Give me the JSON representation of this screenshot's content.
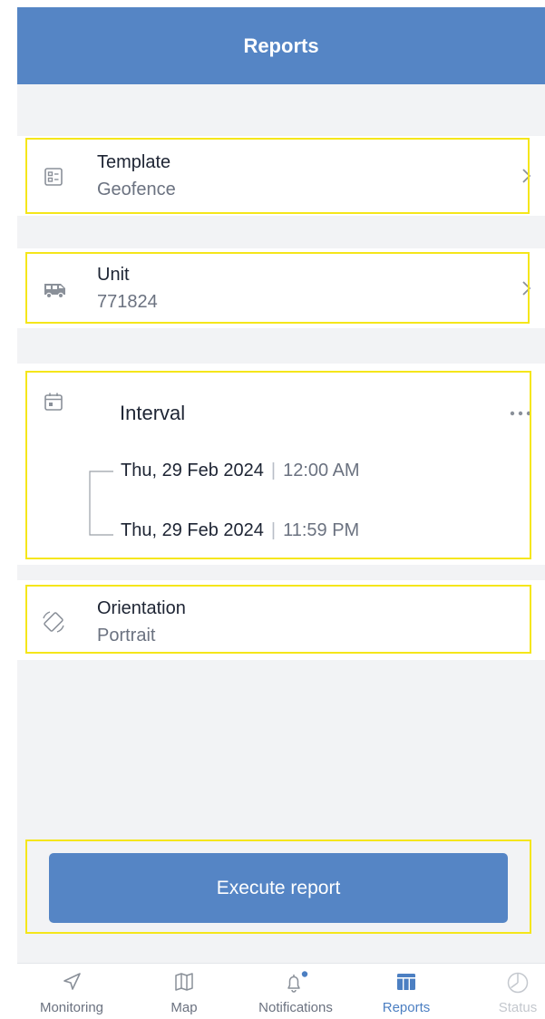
{
  "header": {
    "title": "Reports"
  },
  "template": {
    "title": "Template",
    "value": "Geofence"
  },
  "unit": {
    "title": "Unit",
    "value": "771824"
  },
  "interval": {
    "title": "Interval",
    "from": {
      "date": "Thu, 29 Feb 2024",
      "time": "12:00 AM"
    },
    "to": {
      "date": "Thu, 29 Feb 2024",
      "time": "11:59 PM"
    }
  },
  "orientation": {
    "title": "Orientation",
    "value": "Portrait"
  },
  "execute": {
    "label": "Execute report"
  },
  "tabs": [
    {
      "label": "Monitoring",
      "icon": "navigation-arrow-icon"
    },
    {
      "label": "Map",
      "icon": "map-icon"
    },
    {
      "label": "Notifications",
      "icon": "bell-icon"
    },
    {
      "label": "Reports",
      "icon": "table-icon",
      "active": true
    },
    {
      "label": "Status",
      "icon": "pie-chart-icon"
    }
  ],
  "colors": {
    "header": "#5585c5",
    "accent": "#4c7fc2",
    "highlight": "#f5e61a"
  }
}
